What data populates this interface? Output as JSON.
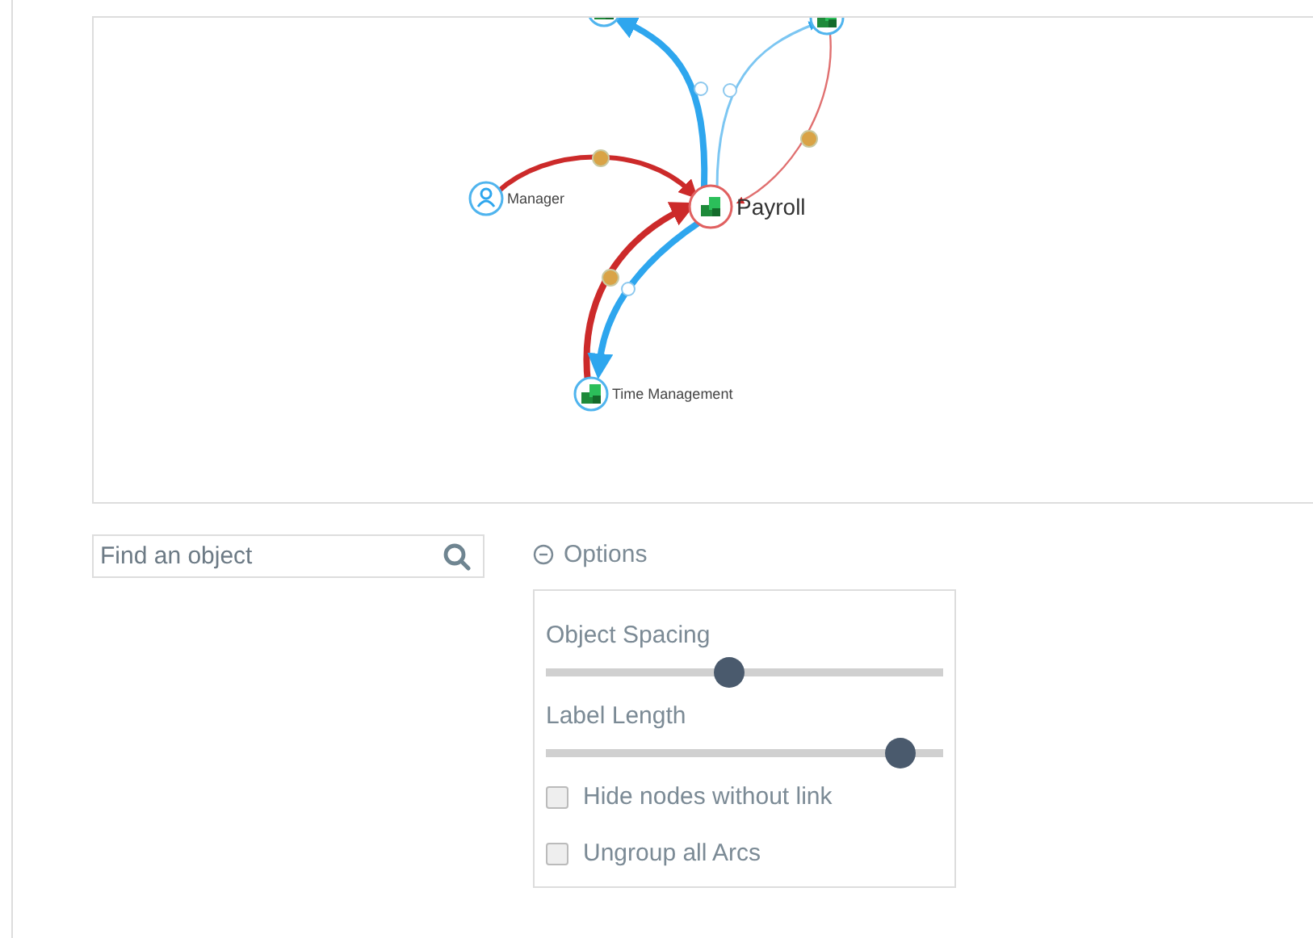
{
  "graph": {
    "nodes": [
      {
        "kind": "puzzle",
        "selected": false
      },
      {
        "kind": "puzzle",
        "selected": false
      },
      {
        "kind": "person",
        "label": "Manager",
        "selected": false
      },
      {
        "kind": "puzzle",
        "label": "Payroll",
        "selected": true
      },
      {
        "kind": "puzzle",
        "label": "Time Management",
        "selected": false
      }
    ]
  },
  "search": {
    "placeholder": "Find an object"
  },
  "options": {
    "label": "Options",
    "expanded": true,
    "sliders": [
      {
        "label": "Object Spacing",
        "level": 0.46
      },
      {
        "label": "Label Length",
        "level": 0.89
      }
    ],
    "checkboxes": [
      {
        "label": "Hide nodes without link",
        "checked": false
      },
      {
        "label": "Ungroup all Arcs",
        "checked": false
      }
    ]
  }
}
